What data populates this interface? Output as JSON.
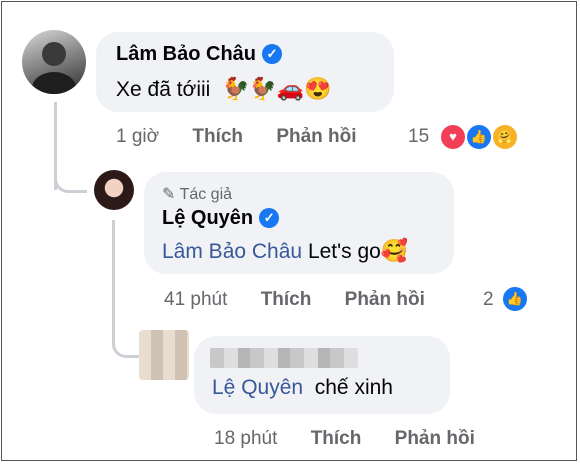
{
  "comment1": {
    "author": "Lâm Bảo Châu",
    "text": "Xe đã tớiii",
    "emojis": "🐓🐓🚗😍",
    "time": "1 giờ",
    "like_label": "Thích",
    "reply_label": "Phản hồi",
    "reaction_count": "15",
    "reactions": [
      "love",
      "like",
      "care"
    ]
  },
  "reply1": {
    "badge": "Tác giả",
    "author": "Lệ Quyên",
    "mention": "Lâm Bảo Châu",
    "text": "Let's go",
    "emoji": "🥰",
    "time": "41 phút",
    "like_label": "Thích",
    "reply_label": "Phản hồi",
    "reaction_count": "2",
    "reactions": [
      "like"
    ]
  },
  "reply2": {
    "mention": "Lệ Quyên",
    "text": "chế xinh",
    "time": "18 phút",
    "like_label": "Thích",
    "reply_label": "Phản hồi"
  },
  "colors": {
    "accent": "#1877f2",
    "bubble": "#f0f2f5",
    "meta": "#65676b",
    "mention": "#385898",
    "love": "#f33e58"
  }
}
